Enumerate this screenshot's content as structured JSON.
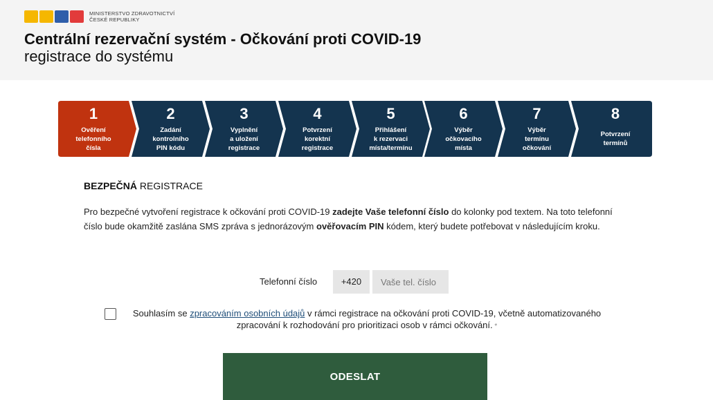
{
  "header": {
    "ministry_line1": "MINISTERSTVO ZDRAVOTNICTVÍ",
    "ministry_line2": "ČESKÉ REPUBLIKY",
    "title": "Centrální rezervační systém - Očkování proti COVID-19",
    "subtitle": "registrace do systému"
  },
  "colors": {
    "active_step": "#c0330f",
    "inactive_step": "#14344f",
    "submit": "#2f5c3d",
    "logo": [
      "#f5b700",
      "#f5b700",
      "#2f5eaa",
      "#e23b3b"
    ]
  },
  "steps": [
    {
      "number": "1",
      "label": "Ověření\ntelefonního\nčísla",
      "active": true
    },
    {
      "number": "2",
      "label": "Zadání\nkontrolního\nPIN kódu",
      "active": false
    },
    {
      "number": "3",
      "label": "Vyplnění\na uložení\nregistrace",
      "active": false
    },
    {
      "number": "4",
      "label": "Potvrzení\nkorektní\nregistrace",
      "active": false
    },
    {
      "number": "5",
      "label": "Přihlášení\nk rezervaci\nmísta/termínu",
      "active": false
    },
    {
      "number": "6",
      "label": "Výběr\nočkovacího\nmísta",
      "active": false
    },
    {
      "number": "7",
      "label": "Výběr\ntermínu\nočkování",
      "active": false
    },
    {
      "number": "8",
      "label": "Potvrzení\ntermínů",
      "active": false
    }
  ],
  "section": {
    "title_bold": "BEZPEČNÁ",
    "title_rest": " REGISTRACE"
  },
  "paragraph": {
    "p1": "Pro bezpečné vytvoření registrace k očkování proti COVID-19 ",
    "p2": "zadejte Vaše telefonní číslo",
    "p3": " do kolonky pod textem. Na toto telefonní číslo bude okamžitě zaslána SMS zpráva s jednorázovým ",
    "p4": "ověřovacím PIN",
    "p5": " kódem, který budete potřebovat v následujícím kroku."
  },
  "phone": {
    "label": "Telefonní číslo",
    "prefix": "+420",
    "placeholder": "Vaše tel. číslo",
    "value": ""
  },
  "consent": {
    "checked": false,
    "text_before": "Souhlasím se ",
    "link_text": "zpracováním osobních údajů",
    "text_after": " v rámci registrace na očkování proti COVID-19, včetně automatizovaného zpracování k rozhodování pro prioritizaci osob v rámci očkování.",
    "required_mark": " *"
  },
  "submit": {
    "label": "ODESLAT"
  }
}
